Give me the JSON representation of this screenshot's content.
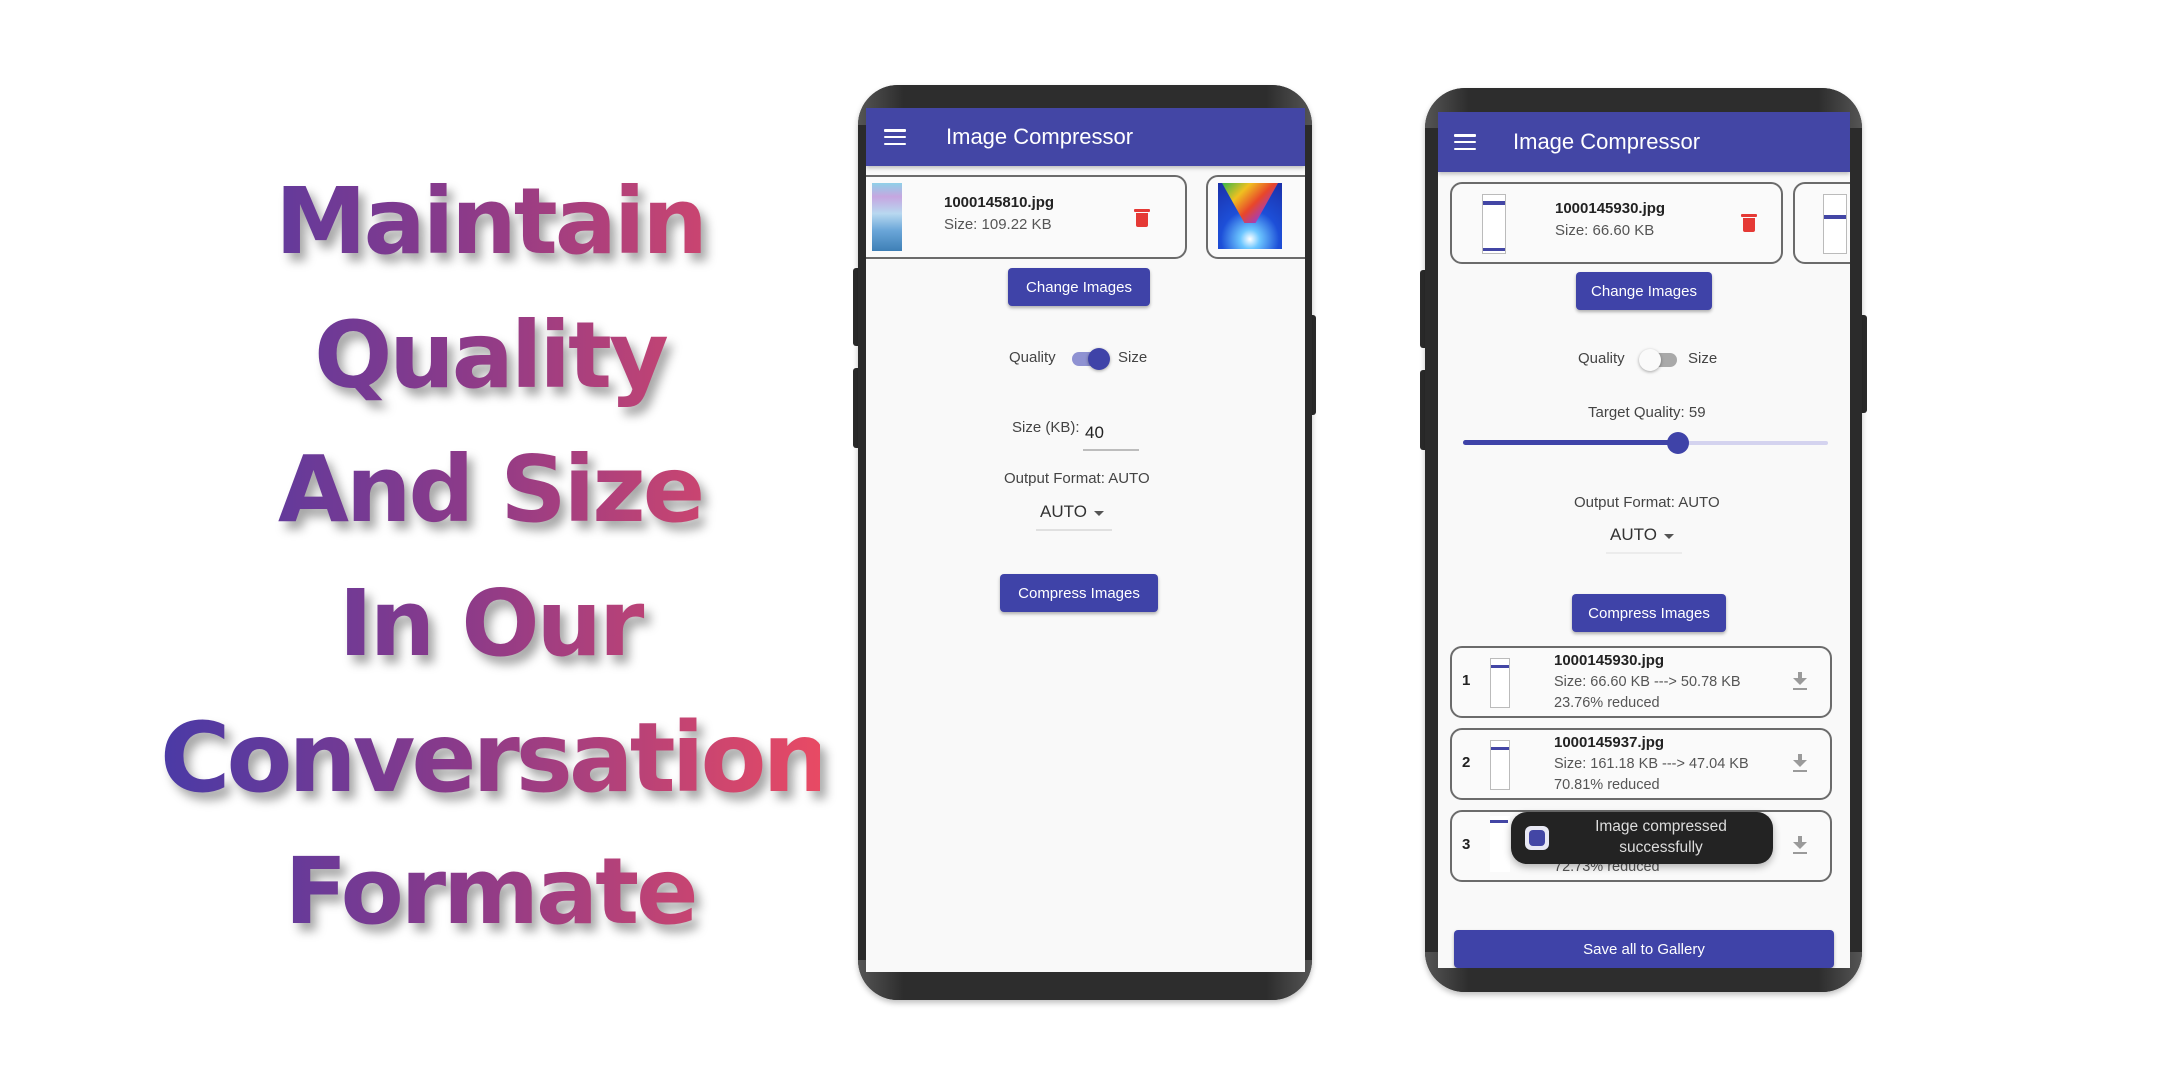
{
  "headline": {
    "lines": [
      "Maintain",
      "Quality",
      "And Size",
      "In Our",
      "Conversation",
      "Formate"
    ],
    "gradient_colors": [
      "#4a3aa6",
      "#8a3a8a",
      "#e84a64"
    ]
  },
  "theme": {
    "primary": "#4346a5",
    "button": "#3f43a8",
    "delete": "#e53935",
    "toast_bg": "#232323"
  },
  "phone1": {
    "app_title": "Image Compressor",
    "selected_images": [
      {
        "name": "1000145810.jpg",
        "size": "Size: 109.22 KB"
      }
    ],
    "change_images_label": "Change Images",
    "mode_left_label": "Quality",
    "mode_right_label": "Size",
    "mode_selected": "Size",
    "size_label": "Size (KB):",
    "size_value": "40",
    "output_format_label": "Output Format: AUTO",
    "format_selected": "AUTO",
    "compress_label": "Compress Images"
  },
  "phone2": {
    "app_title": "Image Compressor",
    "selected_images": [
      {
        "name": "1000145930.jpg",
        "size": "Size: 66.60 KB"
      }
    ],
    "change_images_label": "Change Images",
    "mode_left_label": "Quality",
    "mode_right_label": "Size",
    "mode_selected": "Quality",
    "target_quality_label": "Target Quality: 59",
    "target_quality_value": 59,
    "target_quality_range": [
      0,
      100
    ],
    "output_format_label": "Output Format: AUTO",
    "format_selected": "AUTO",
    "compress_label": "Compress Images",
    "results": [
      {
        "index": "1",
        "name": "1000145930.jpg",
        "size": "Size: 66.60 KB  --->  50.78 KB",
        "reduced": "23.76% reduced"
      },
      {
        "index": "2",
        "name": "1000145937.jpg",
        "size": "Size: 161.18 KB  --->  47.04 KB",
        "reduced": "70.81% reduced"
      },
      {
        "index": "3",
        "name": "",
        "size": "",
        "reduced": "72.73% reduced"
      }
    ],
    "toast": "Image compressed successfully",
    "save_all_label": "Save all to Gallery"
  }
}
